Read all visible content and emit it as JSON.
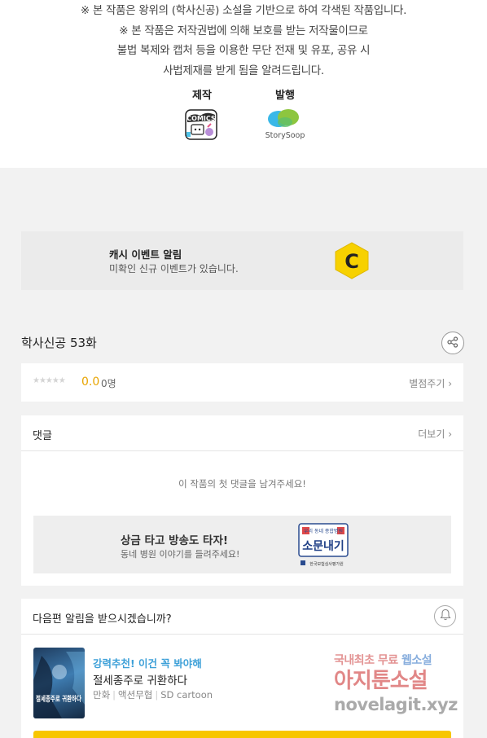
{
  "notice": {
    "line1": "※ 본 작품은 왕위의 (학사신공) 소설을 기반으로 하여 각색된 작품입니다.",
    "line2": "※ 본 작품은 저작권법에 의해 보호를 받는 저작물이므로",
    "line3": "불법 복제와 캡처 등을 이용한 무단 전재 및 유포, 공유 시",
    "line4": "사법제재를 받게 됨을 알려드립니다."
  },
  "credits": {
    "production_label": "제작",
    "production_logo_text": "COMICS",
    "publisher_label": "발행",
    "publisher_logo_text": "StorySoop"
  },
  "event": {
    "title": "캐시 이벤트 알림",
    "subtitle": "미확인 신규 이벤트가 있습니다.",
    "icon": "cash-coin-icon",
    "icon_letter": "C",
    "icon_color": "#f7d100"
  },
  "episode": {
    "title": "학사신공 53화",
    "share_icon": "share-icon"
  },
  "rating": {
    "stars": "★★★★★",
    "score": "0.0",
    "count": "0명",
    "rate_link": "별점주기 ›"
  },
  "comments": {
    "title": "댓글",
    "more_link": "더보기 ›",
    "empty_message": "이 작품의 첫 댓글을 남겨주세요!",
    "banner": {
      "title": "상금 타고 방송도 타자!",
      "subtitle": "동네 병원 이야기를 들려주세요!",
      "art_line1": "우리 동네 종합병원",
      "art_line2": "소문내기",
      "art_footer": "한국보험심사평가원"
    }
  },
  "next_notify": {
    "title": "다음편 알림을 받으시겠습니까?",
    "bell_icon": "bell-icon"
  },
  "recommendation": {
    "tag": "강력추천! 이건 꼭 봐야해",
    "title": "절세종주로 귀환하다",
    "genre1": "만화",
    "genre2": "액션무협",
    "publisher": "SD cartoon",
    "thumb_text": "절세종주로 귀환하다"
  },
  "watermark": {
    "line1_a": "국내최초 무료 ",
    "line1_b": "웹소설",
    "line2": "아지툰소설",
    "line3": "novelagit.xyz"
  },
  "colors": {
    "accent_yellow": "#f7c600",
    "rating_score": "#e8a400",
    "tag_blue": "#3da0d8"
  }
}
